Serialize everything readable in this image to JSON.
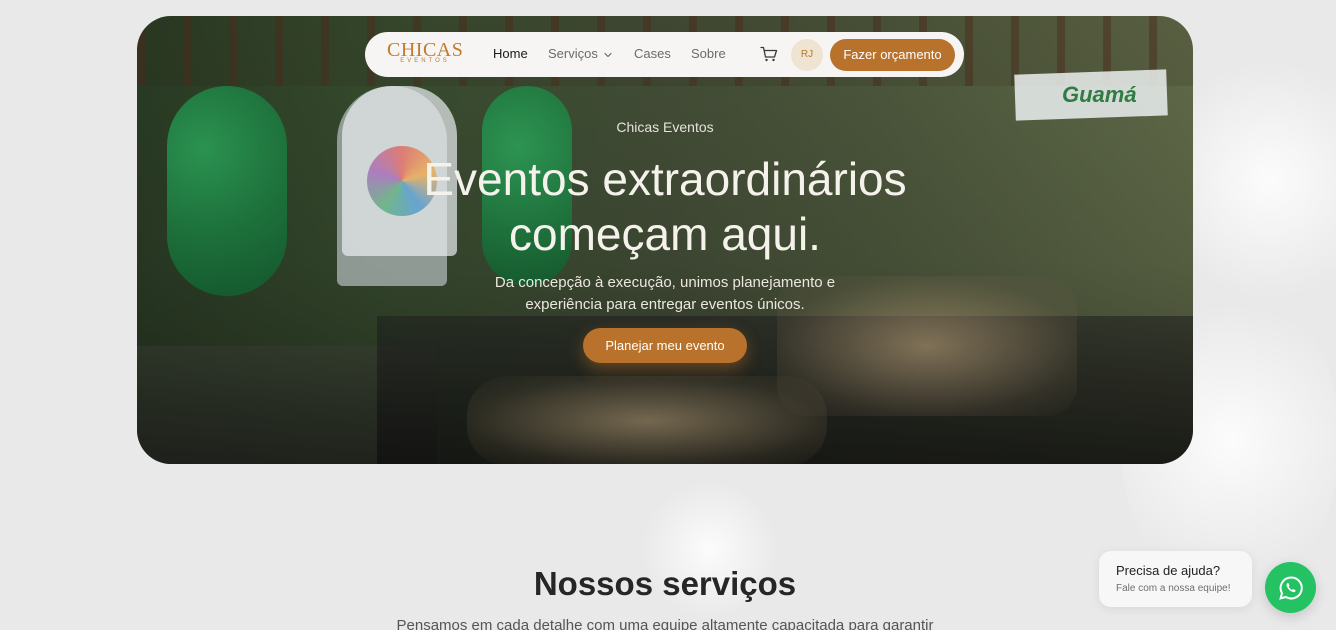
{
  "colors": {
    "accent": "#b8722b",
    "accent_light": "#efe3d2",
    "page_bg": "#e9e9ea",
    "nav_bg": "#f6f5f3",
    "whatsapp": "#25c264"
  },
  "nav": {
    "logo": {
      "main": "CHICAS",
      "sub": "EVENTOS"
    },
    "links": [
      {
        "label": "Home",
        "active": true
      },
      {
        "label": "Serviços",
        "has_dropdown": true
      },
      {
        "label": "Cases"
      },
      {
        "label": "Sobre"
      }
    ],
    "cart_icon": "cart-icon",
    "avatar_initials": "RJ",
    "cta": "Fazer orçamento"
  },
  "hero": {
    "photo_sign_text": "Guamá",
    "eyebrow": "Chicas Eventos",
    "headline_line1": "Eventos extraordinários",
    "headline_line2": "começam aqui.",
    "sub_line1": "Da concepção à execução, unimos planejamento e",
    "sub_line2": "experiência para entregar eventos únicos.",
    "cta": "Planejar meu evento"
  },
  "services": {
    "title": "Nossos serviços",
    "subtitle": "Pensamos em cada detalhe com uma equipe altamente capacitada para garantir"
  },
  "help_widget": {
    "title": "Precisa de ajuda?",
    "subtitle": "Fale com a nossa equipe!",
    "icon": "whatsapp-icon"
  }
}
